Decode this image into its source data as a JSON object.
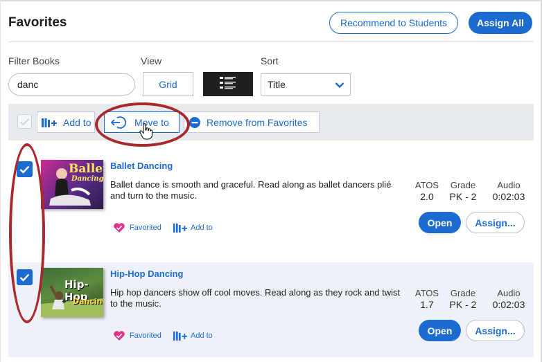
{
  "header": {
    "title": "Favorites",
    "recommend_label": "Recommend to Students",
    "assign_all_label": "Assign All"
  },
  "controls": {
    "filter_label": "Filter Books",
    "filter_value": "danc",
    "view_label": "View",
    "grid_label": "Grid",
    "sort_label": "Sort",
    "sort_value": "Title"
  },
  "action_bar": {
    "add_to_label": "Add to",
    "move_to_label": "Move to",
    "remove_label": "Remove from Favorites"
  },
  "books": [
    {
      "title": "Ballet Dancing",
      "description": "Ballet dance is smooth and graceful. Read along as ballet dancers plié and turn to the music.",
      "cover_title": "Ballet",
      "cover_sub": "Dancing",
      "atos_label": "ATOS",
      "atos": "2.0",
      "grade_label": "Grade",
      "grade": "PK - 2",
      "audio_label": "Audio",
      "audio": "0:02:03",
      "favorited_label": "Favorited",
      "add_to_label": "Add to",
      "open_label": "Open",
      "assign_label": "Assign..."
    },
    {
      "title": "Hip-Hop Dancing",
      "description": "Hip hop dancers show off cool moves. Read along as they rock and twist to the music.",
      "cover_title": "Hip-Hop",
      "cover_sub": "Dancing",
      "atos_label": "ATOS",
      "atos": "1.7",
      "grade_label": "Grade",
      "grade": "PK - 2",
      "audio_label": "Audio",
      "audio": "0:02:03",
      "favorited_label": "Favorited",
      "add_to_label": "Add to",
      "open_label": "Open",
      "assign_label": "Assign..."
    }
  ],
  "colors": {
    "accent": "#1b6bd0",
    "annotation": "#a8282b",
    "favorite_heart": "#e0368a"
  }
}
